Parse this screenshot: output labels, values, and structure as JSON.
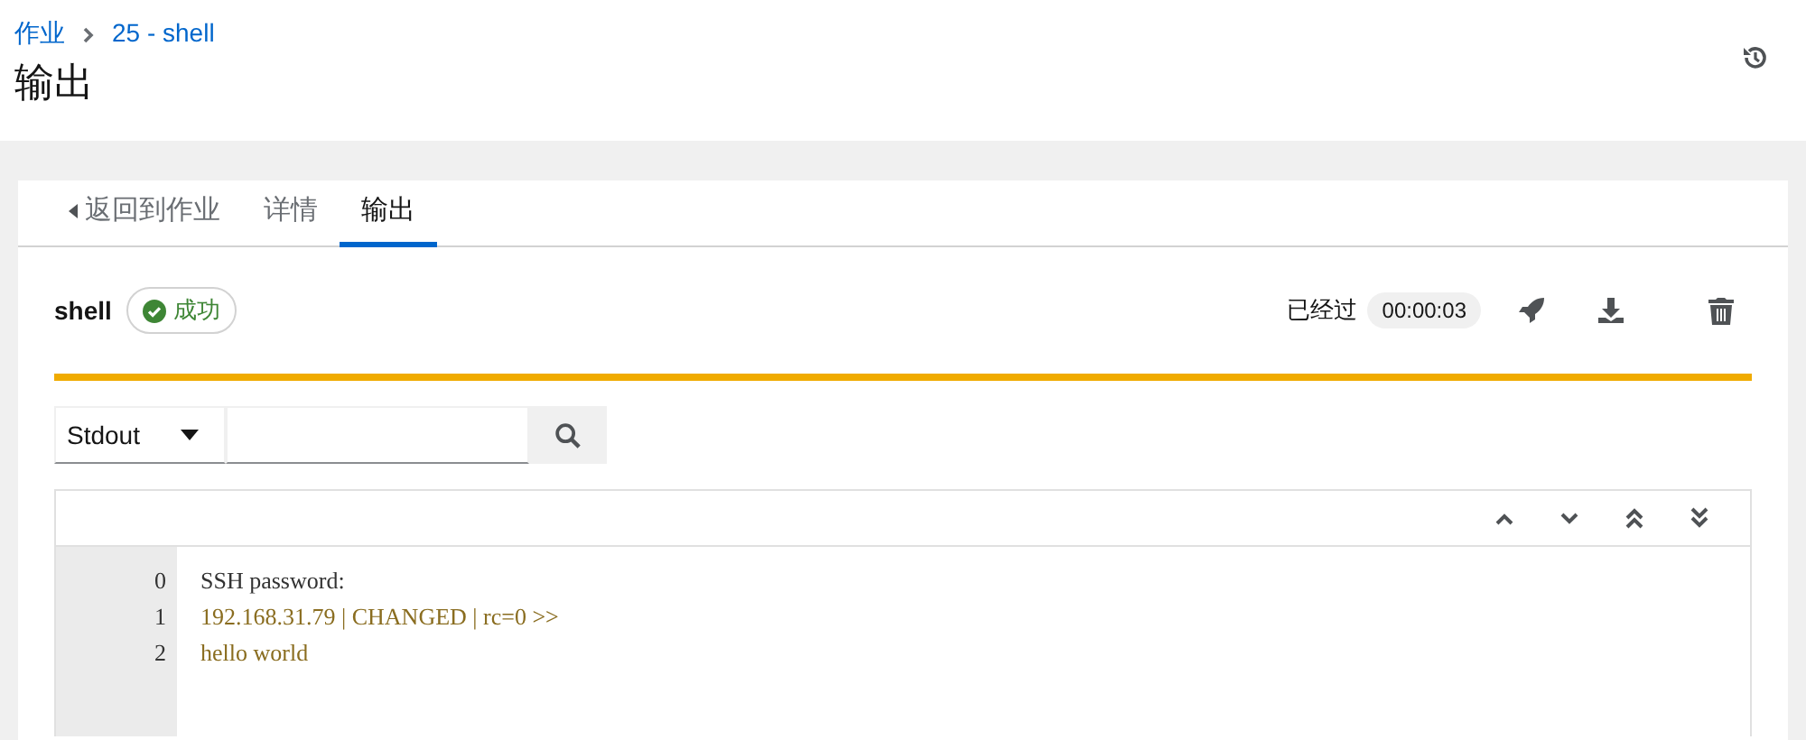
{
  "breadcrumb": [
    {
      "label": "作业"
    },
    {
      "label": "25 - shell"
    }
  ],
  "page_title": "输出",
  "tabs": [
    {
      "label": "返回到作业",
      "kind": "back",
      "selected": false
    },
    {
      "label": "详情",
      "kind": "tab",
      "selected": false
    },
    {
      "label": "输出",
      "kind": "tab",
      "selected": true
    }
  ],
  "job": {
    "name": "shell",
    "status": "成功",
    "elapsed_label": "已经过",
    "elapsed": "00:00:03",
    "progress": {
      "level": 1
    }
  },
  "search": {
    "filter": "Stdout"
  },
  "output": {
    "lines": [
      {
        "number": "0",
        "text": "SSH password:",
        "kind": "plain"
      },
      {
        "number": "1",
        "text": "192.168.31.79 | CHANGED | rc=0 >>",
        "kind": "changed"
      },
      {
        "number": "2",
        "text": "hello world",
        "kind": "changed"
      }
    ]
  }
}
